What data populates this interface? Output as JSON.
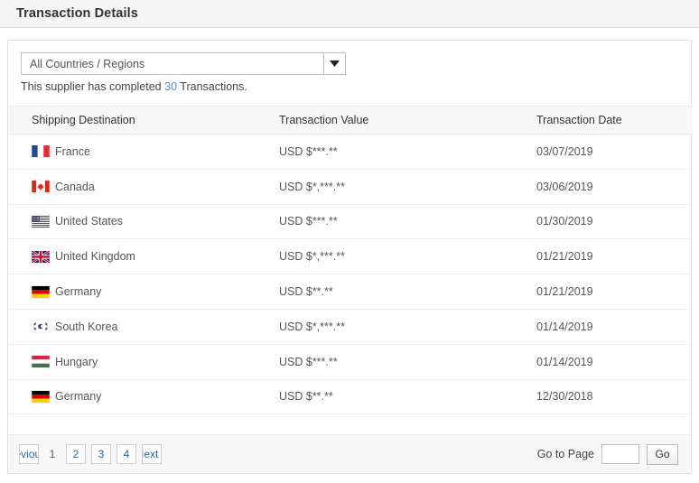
{
  "header": {
    "title": "Transaction Details"
  },
  "filter": {
    "selected": "All Countries / Regions",
    "dropdown_icon": "chevron-down-icon",
    "supplier_prefix": "This supplier has completed",
    "transaction_count": "30",
    "supplier_suffix": "Transactions."
  },
  "table": {
    "columns": [
      "Shipping Destination",
      "Transaction Value",
      "Transaction Date"
    ],
    "rows": [
      {
        "flag": "flag-france",
        "destination": "France",
        "value": "USD $***.**",
        "date": "03/07/2019"
      },
      {
        "flag": "flag-canada",
        "destination": "Canada",
        "value": "USD $*,***.**",
        "date": "03/06/2019"
      },
      {
        "flag": "flag-united-states",
        "destination": "United States",
        "value": "USD $***.**",
        "date": "01/30/2019"
      },
      {
        "flag": "flag-united-kingdom",
        "destination": "United Kingdom",
        "value": "USD $*,***.**",
        "date": "01/21/2019"
      },
      {
        "flag": "flag-germany",
        "destination": "Germany",
        "value": "USD $**.**",
        "date": "01/21/2019"
      },
      {
        "flag": "flag-south-korea",
        "destination": "South Korea",
        "value": "USD $*,***.**",
        "date": "01/14/2019"
      },
      {
        "flag": "flag-hungary",
        "destination": "Hungary",
        "value": "USD $***.**",
        "date": "01/14/2019"
      },
      {
        "flag": "flag-germany",
        "destination": "Germany",
        "value": "USD $**.**",
        "date": "12/30/2018"
      }
    ]
  },
  "pagination": {
    "previous_label": "Previous",
    "next_label": "Next",
    "current_page": "1",
    "pages": [
      "2",
      "3",
      "4"
    ],
    "goto_label": "Go to Page",
    "goto_value": "",
    "goto_button": "Go"
  },
  "colors": {
    "link": "#4a90d9",
    "pager_link": "#2a6496",
    "header_bg": "#f5f5f5",
    "row_border": "#eeeeee"
  }
}
